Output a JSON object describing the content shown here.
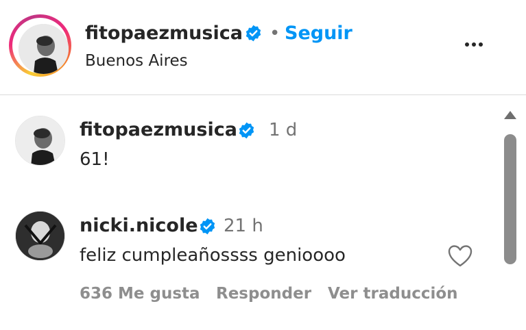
{
  "header": {
    "username": "fitopaezmusica",
    "separator": "•",
    "follow_label": "Seguir",
    "location": "Buenos Aires",
    "more_icon": "more-horizontal-icon"
  },
  "comments": [
    {
      "username": "fitopaezmusica",
      "verified": true,
      "time": "1 d",
      "text": "61!"
    },
    {
      "username": "nicki.nicole",
      "verified": true,
      "time": "21 h",
      "text": "feliz cumpleañossss genioooo",
      "likes": "636 Me gusta",
      "reply_label": "Responder",
      "translate_label": "Ver traducción",
      "like_icon": "heart-outline-icon"
    }
  ],
  "colors": {
    "accent": "#0095f6",
    "verified": "#0095f6",
    "muted": "#737373",
    "text": "#262626"
  }
}
